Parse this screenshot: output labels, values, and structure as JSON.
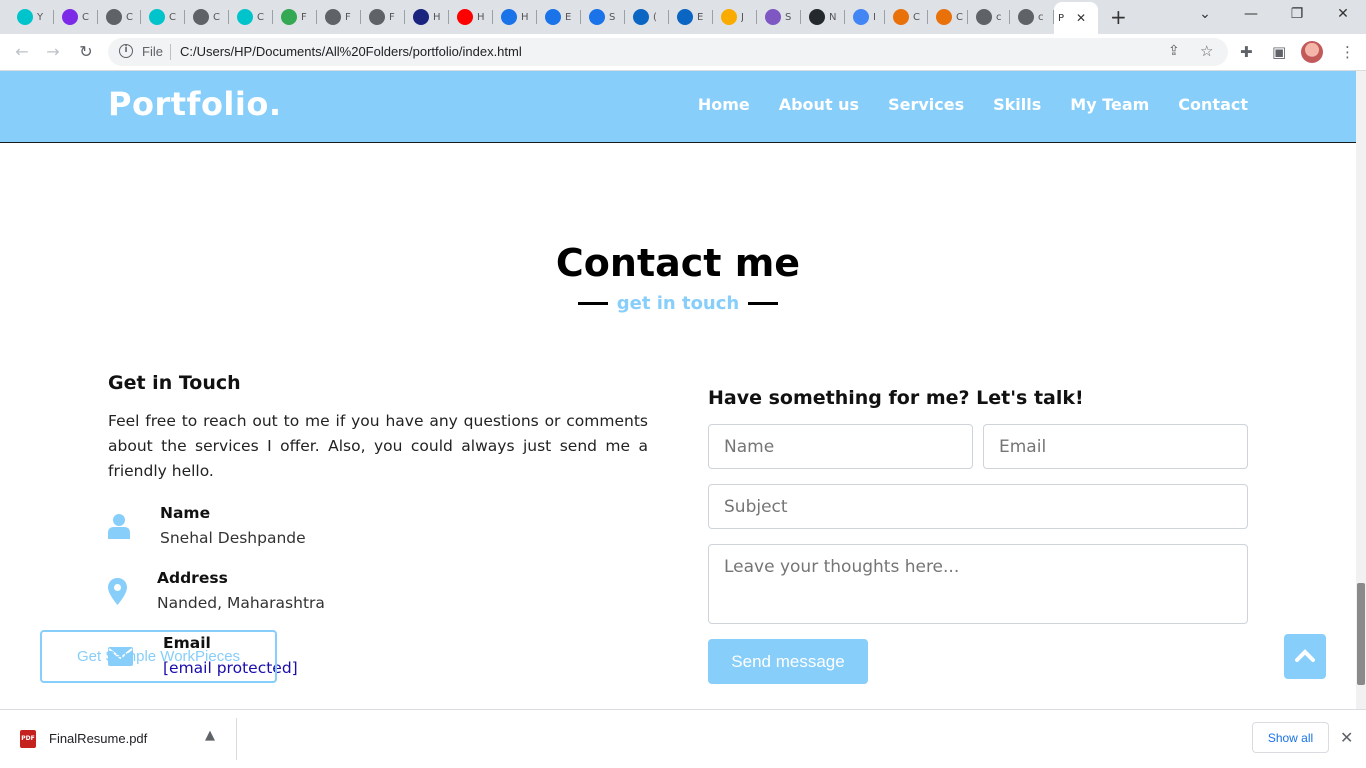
{
  "browser": {
    "tabs": [
      {
        "icon": "canva-icon",
        "title": "Y",
        "color": "#00c4cc"
      },
      {
        "icon": "canva-icon",
        "title": "C",
        "color": "#7d2ae8"
      },
      {
        "icon": "globe-icon",
        "title": "C",
        "color": "#5f6368"
      },
      {
        "icon": "canva-icon",
        "title": "C",
        "color": "#00c4cc"
      },
      {
        "icon": "globe-icon",
        "title": "C",
        "color": "#5f6368"
      },
      {
        "icon": "canva-icon",
        "title": "C",
        "color": "#00c4cc"
      },
      {
        "icon": "drive-icon",
        "title": "F",
        "color": "#34a853"
      },
      {
        "icon": "globe-icon",
        "title": "F",
        "color": "#5f6368"
      },
      {
        "icon": "globe-icon",
        "title": "F",
        "color": "#5f6368"
      },
      {
        "icon": "p-icon",
        "title": "H",
        "color": "#1a237e"
      },
      {
        "icon": "youtube-icon",
        "title": "H",
        "color": "#ff0000"
      },
      {
        "icon": "arrow-icon",
        "title": "H",
        "color": "#1a73e8"
      },
      {
        "icon": "arrow-icon",
        "title": "E",
        "color": "#1a73e8"
      },
      {
        "icon": "arrow-icon",
        "title": "S",
        "color": "#1a73e8"
      },
      {
        "icon": "linkedin-icon",
        "title": "(",
        "color": "#0a66c2"
      },
      {
        "icon": "linkedin-icon",
        "title": "E",
        "color": "#0a66c2"
      },
      {
        "icon": "bars-icon",
        "title": "J",
        "color": "#f9ab00"
      },
      {
        "icon": "swirl-icon",
        "title": "S",
        "color": "#7e57c2"
      },
      {
        "icon": "github-icon",
        "title": "N",
        "color": "#24292e"
      },
      {
        "icon": "google-icon",
        "title": "I",
        "color": "#4285f4"
      },
      {
        "icon": "gfg-icon",
        "title": "C",
        "color": "#e8710a"
      },
      {
        "icon": "gfg-icon",
        "title": "C",
        "color": "#e8710a"
      },
      {
        "icon": "globe-icon",
        "title": "c",
        "color": "#5f6368"
      },
      {
        "icon": "globe-icon",
        "title": "c",
        "color": "#5f6368"
      }
    ],
    "active_tab": {
      "title": "P",
      "close": "✕"
    },
    "new_tab": "+",
    "window_controls": {
      "chevron": "⌄",
      "minimize": "—",
      "restore": "❐",
      "close": "✕"
    },
    "nav": {
      "back": "←",
      "forward": "→",
      "reload": "↻"
    },
    "omnibox": {
      "info": "i",
      "scheme": "File",
      "url": "C:/Users/HP/Documents/All%20Folders/portfolio/index.html"
    }
  },
  "site": {
    "logo": "Portfolio.",
    "menu": [
      "Home",
      "About us",
      "Services",
      "Skills",
      "My Team",
      "Contact"
    ],
    "accent_color": "#87cefa"
  },
  "contact": {
    "title": "Contact me",
    "subtitle": "get in touch",
    "left": {
      "heading": "Get in Touch",
      "paragraph": "Feel free to reach out to me if you have any questions or comments about the services I offer. Also, you could always just send me a friendly hello.",
      "items": [
        {
          "icon": "user-icon",
          "label": "Name",
          "value": "Snehal Deshpande"
        },
        {
          "icon": "map-marker-icon",
          "label": "Address",
          "value": "Nanded, Maharashtra"
        },
        {
          "icon": "envelope-icon",
          "label": "Email",
          "value": "[email protected]"
        }
      ]
    },
    "sample_button": "Get Sample WorkPieces",
    "right": {
      "heading": "Have something for me? Let's talk!",
      "name_placeholder": "Name",
      "email_placeholder": "Email",
      "subject_placeholder": "Subject",
      "message_placeholder": "Leave your thoughts here...",
      "send_label": "Send message"
    }
  },
  "downloads": {
    "file_name": "FinalResume.pdf",
    "file_type": "PDF",
    "show_all": "Show all",
    "close": "✕"
  }
}
